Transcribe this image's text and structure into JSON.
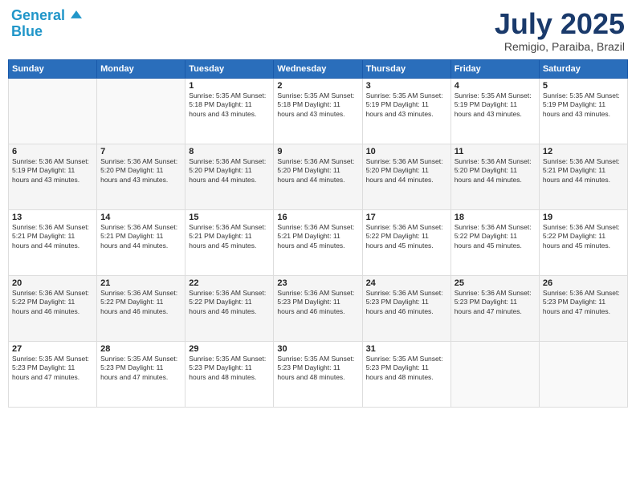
{
  "header": {
    "logo_line1": "General",
    "logo_line2": "Blue",
    "month": "July 2025",
    "location": "Remigio, Paraiba, Brazil"
  },
  "days_of_week": [
    "Sunday",
    "Monday",
    "Tuesday",
    "Wednesday",
    "Thursday",
    "Friday",
    "Saturday"
  ],
  "weeks": [
    [
      {
        "day": "",
        "info": ""
      },
      {
        "day": "",
        "info": ""
      },
      {
        "day": "1",
        "info": "Sunrise: 5:35 AM\nSunset: 5:18 PM\nDaylight: 11 hours and 43 minutes."
      },
      {
        "day": "2",
        "info": "Sunrise: 5:35 AM\nSunset: 5:18 PM\nDaylight: 11 hours and 43 minutes."
      },
      {
        "day": "3",
        "info": "Sunrise: 5:35 AM\nSunset: 5:19 PM\nDaylight: 11 hours and 43 minutes."
      },
      {
        "day": "4",
        "info": "Sunrise: 5:35 AM\nSunset: 5:19 PM\nDaylight: 11 hours and 43 minutes."
      },
      {
        "day": "5",
        "info": "Sunrise: 5:35 AM\nSunset: 5:19 PM\nDaylight: 11 hours and 43 minutes."
      }
    ],
    [
      {
        "day": "6",
        "info": "Sunrise: 5:36 AM\nSunset: 5:19 PM\nDaylight: 11 hours and 43 minutes."
      },
      {
        "day": "7",
        "info": "Sunrise: 5:36 AM\nSunset: 5:20 PM\nDaylight: 11 hours and 43 minutes."
      },
      {
        "day": "8",
        "info": "Sunrise: 5:36 AM\nSunset: 5:20 PM\nDaylight: 11 hours and 44 minutes."
      },
      {
        "day": "9",
        "info": "Sunrise: 5:36 AM\nSunset: 5:20 PM\nDaylight: 11 hours and 44 minutes."
      },
      {
        "day": "10",
        "info": "Sunrise: 5:36 AM\nSunset: 5:20 PM\nDaylight: 11 hours and 44 minutes."
      },
      {
        "day": "11",
        "info": "Sunrise: 5:36 AM\nSunset: 5:20 PM\nDaylight: 11 hours and 44 minutes."
      },
      {
        "day": "12",
        "info": "Sunrise: 5:36 AM\nSunset: 5:21 PM\nDaylight: 11 hours and 44 minutes."
      }
    ],
    [
      {
        "day": "13",
        "info": "Sunrise: 5:36 AM\nSunset: 5:21 PM\nDaylight: 11 hours and 44 minutes."
      },
      {
        "day": "14",
        "info": "Sunrise: 5:36 AM\nSunset: 5:21 PM\nDaylight: 11 hours and 44 minutes."
      },
      {
        "day": "15",
        "info": "Sunrise: 5:36 AM\nSunset: 5:21 PM\nDaylight: 11 hours and 45 minutes."
      },
      {
        "day": "16",
        "info": "Sunrise: 5:36 AM\nSunset: 5:21 PM\nDaylight: 11 hours and 45 minutes."
      },
      {
        "day": "17",
        "info": "Sunrise: 5:36 AM\nSunset: 5:22 PM\nDaylight: 11 hours and 45 minutes."
      },
      {
        "day": "18",
        "info": "Sunrise: 5:36 AM\nSunset: 5:22 PM\nDaylight: 11 hours and 45 minutes."
      },
      {
        "day": "19",
        "info": "Sunrise: 5:36 AM\nSunset: 5:22 PM\nDaylight: 11 hours and 45 minutes."
      }
    ],
    [
      {
        "day": "20",
        "info": "Sunrise: 5:36 AM\nSunset: 5:22 PM\nDaylight: 11 hours and 46 minutes."
      },
      {
        "day": "21",
        "info": "Sunrise: 5:36 AM\nSunset: 5:22 PM\nDaylight: 11 hours and 46 minutes."
      },
      {
        "day": "22",
        "info": "Sunrise: 5:36 AM\nSunset: 5:22 PM\nDaylight: 11 hours and 46 minutes."
      },
      {
        "day": "23",
        "info": "Sunrise: 5:36 AM\nSunset: 5:23 PM\nDaylight: 11 hours and 46 minutes."
      },
      {
        "day": "24",
        "info": "Sunrise: 5:36 AM\nSunset: 5:23 PM\nDaylight: 11 hours and 46 minutes."
      },
      {
        "day": "25",
        "info": "Sunrise: 5:36 AM\nSunset: 5:23 PM\nDaylight: 11 hours and 47 minutes."
      },
      {
        "day": "26",
        "info": "Sunrise: 5:36 AM\nSunset: 5:23 PM\nDaylight: 11 hours and 47 minutes."
      }
    ],
    [
      {
        "day": "27",
        "info": "Sunrise: 5:35 AM\nSunset: 5:23 PM\nDaylight: 11 hours and 47 minutes."
      },
      {
        "day": "28",
        "info": "Sunrise: 5:35 AM\nSunset: 5:23 PM\nDaylight: 11 hours and 47 minutes."
      },
      {
        "day": "29",
        "info": "Sunrise: 5:35 AM\nSunset: 5:23 PM\nDaylight: 11 hours and 48 minutes."
      },
      {
        "day": "30",
        "info": "Sunrise: 5:35 AM\nSunset: 5:23 PM\nDaylight: 11 hours and 48 minutes."
      },
      {
        "day": "31",
        "info": "Sunrise: 5:35 AM\nSunset: 5:23 PM\nDaylight: 11 hours and 48 minutes."
      },
      {
        "day": "",
        "info": ""
      },
      {
        "day": "",
        "info": ""
      }
    ]
  ]
}
